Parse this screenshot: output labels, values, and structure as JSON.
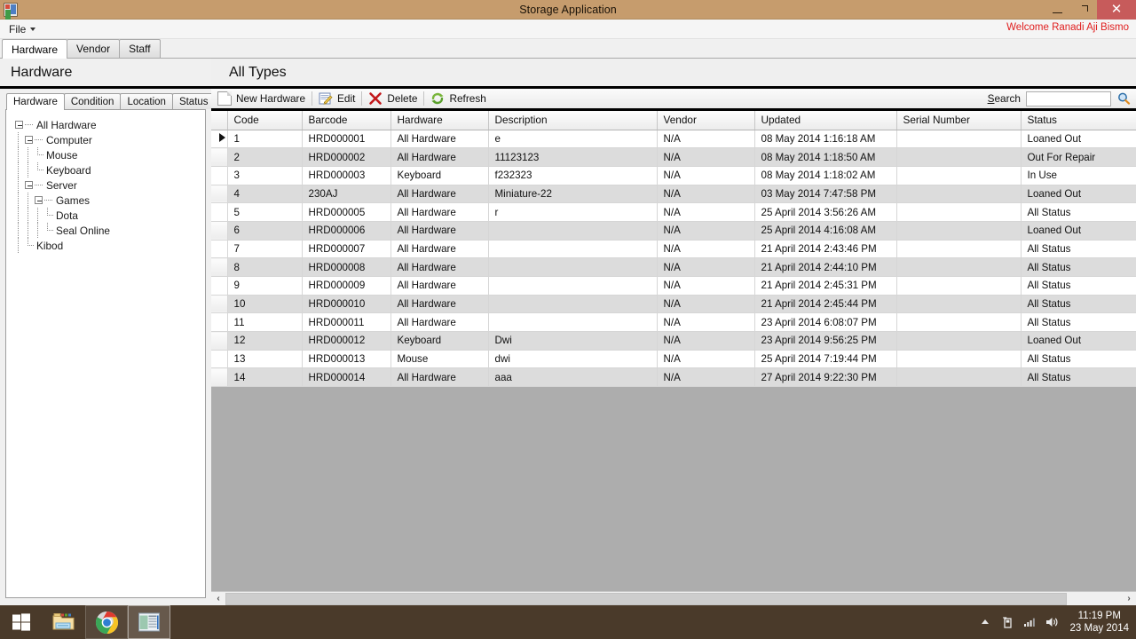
{
  "window": {
    "title": "Storage Application",
    "app_icon": "application-icon",
    "minimize_label": "minimize",
    "maximize_label": "restore",
    "close_label": "close"
  },
  "menu": {
    "file_label": "File",
    "welcome_text": "Welcome Ranadi Aji Bismo",
    "welcome_color": "#e02020"
  },
  "tabs": [
    {
      "label": "Hardware",
      "active": true
    },
    {
      "label": "Vendor",
      "active": false
    },
    {
      "label": "Staff",
      "active": false
    }
  ],
  "header": {
    "page_title": "Hardware",
    "type_title": "All Types"
  },
  "tree_tabs": [
    {
      "label": "Hardware",
      "active": true
    },
    {
      "label": "Condition",
      "active": false
    },
    {
      "label": "Location",
      "active": false
    },
    {
      "label": "Status",
      "active": false
    }
  ],
  "tree": [
    {
      "label": "All Hardware",
      "level": 0,
      "expander": true
    },
    {
      "label": "Computer",
      "level": 1,
      "expander": true
    },
    {
      "label": "Mouse",
      "level": 2,
      "expander": false
    },
    {
      "label": "Keyboard",
      "level": 2,
      "expander": false
    },
    {
      "label": "Server",
      "level": 1,
      "expander": true
    },
    {
      "label": "Games",
      "level": 2,
      "expander": true
    },
    {
      "label": "Dota",
      "level": 3,
      "expander": false
    },
    {
      "label": "Seal Online",
      "level": 3,
      "expander": false
    },
    {
      "label": "Kibod",
      "level": 1,
      "expander": false
    }
  ],
  "toolbar": {
    "new_hardware_label": "New Hardware",
    "edit_label": "Edit",
    "delete_label": "Delete",
    "refresh_label": "Refresh",
    "search_label_prefix": "S",
    "search_label_rest": "earch",
    "search_value": "",
    "search_placeholder": ""
  },
  "grid": {
    "columns": [
      "Code",
      "Barcode",
      "Hardware",
      "Description",
      "Vendor",
      "Updated",
      "Serial Number",
      "Status"
    ],
    "selected_row_index": 0,
    "rows": [
      {
        "code": "1",
        "barcode": "HRD000001",
        "hardware": "All Hardware",
        "description": "e",
        "vendor": "N/A",
        "updated": "08 May 2014 1:16:18 AM",
        "serial": "",
        "status": "Loaned Out"
      },
      {
        "code": "2",
        "barcode": "HRD000002",
        "hardware": "All Hardware",
        "description": "11123123",
        "vendor": "N/A",
        "updated": "08 May 2014 1:18:50 AM",
        "serial": "",
        "status": "Out For Repair"
      },
      {
        "code": "3",
        "barcode": "HRD000003",
        "hardware": "Keyboard",
        "description": "f232323",
        "vendor": "N/A",
        "updated": "08 May 2014 1:18:02 AM",
        "serial": "",
        "status": "In Use"
      },
      {
        "code": "4",
        "barcode": "230AJ",
        "hardware": "All Hardware",
        "description": "Miniature-22",
        "vendor": "N/A",
        "updated": "03 May 2014 7:47:58 PM",
        "serial": "",
        "status": "Loaned Out"
      },
      {
        "code": "5",
        "barcode": "HRD000005",
        "hardware": "All Hardware",
        "description": "r",
        "vendor": "N/A",
        "updated": "25 April 2014 3:56:26 AM",
        "serial": "",
        "status": "All Status"
      },
      {
        "code": "6",
        "barcode": "HRD000006",
        "hardware": "All Hardware",
        "description": "",
        "vendor": "N/A",
        "updated": "25 April 2014 4:16:08 AM",
        "serial": "",
        "status": "Loaned Out"
      },
      {
        "code": "7",
        "barcode": "HRD000007",
        "hardware": "All Hardware",
        "description": "",
        "vendor": "N/A",
        "updated": "21 April 2014 2:43:46 PM",
        "serial": "",
        "status": "All Status"
      },
      {
        "code": "8",
        "barcode": "HRD000008",
        "hardware": "All Hardware",
        "description": "",
        "vendor": "N/A",
        "updated": "21 April 2014 2:44:10 PM",
        "serial": "",
        "status": "All Status"
      },
      {
        "code": "9",
        "barcode": "HRD000009",
        "hardware": "All Hardware",
        "description": "",
        "vendor": "N/A",
        "updated": "21 April 2014 2:45:31 PM",
        "serial": "",
        "status": "All Status"
      },
      {
        "code": "10",
        "barcode": "HRD000010",
        "hardware": "All Hardware",
        "description": "",
        "vendor": "N/A",
        "updated": "21 April 2014 2:45:44 PM",
        "serial": "",
        "status": "All Status"
      },
      {
        "code": "11",
        "barcode": "HRD000011",
        "hardware": "All Hardware",
        "description": "",
        "vendor": "N/A",
        "updated": "23 April 2014 6:08:07 PM",
        "serial": "",
        "status": "All Status"
      },
      {
        "code": "12",
        "barcode": "HRD000012",
        "hardware": "Keyboard",
        "description": "Dwi",
        "vendor": "N/A",
        "updated": "23 April 2014 9:56:25 PM",
        "serial": "",
        "status": "Loaned Out"
      },
      {
        "code": "13",
        "barcode": "HRD000013",
        "hardware": "Mouse",
        "description": "dwi",
        "vendor": "N/A",
        "updated": "25 April 2014 7:19:44 PM",
        "serial": "",
        "status": "All Status"
      },
      {
        "code": "14",
        "barcode": "HRD000014",
        "hardware": "All Hardware",
        "description": "aaa",
        "vendor": "N/A",
        "updated": "27 April 2014 9:22:30 PM",
        "serial": "",
        "status": "All Status"
      }
    ]
  },
  "scrollbar": {
    "left_arrow": "‹",
    "right_arrow": "›"
  },
  "taskbar": {
    "start_label": "start-button",
    "items": [
      {
        "name": "file-explorer",
        "active": false
      },
      {
        "name": "google-chrome",
        "active": false
      },
      {
        "name": "storage-application",
        "active": true
      }
    ],
    "tray": {
      "show_hidden": "▲",
      "removable_media": "usb-icon",
      "network": "network-icon",
      "volume": "volume-icon"
    },
    "clock_time": "11:19 PM",
    "clock_date": "23 May 2014"
  },
  "colors": {
    "title_bar": "#c69c6d",
    "close_button": "#c75b5b",
    "welcome": "#e02020",
    "grid_empty": "#adadad",
    "taskbar": "#4a3a2a"
  }
}
